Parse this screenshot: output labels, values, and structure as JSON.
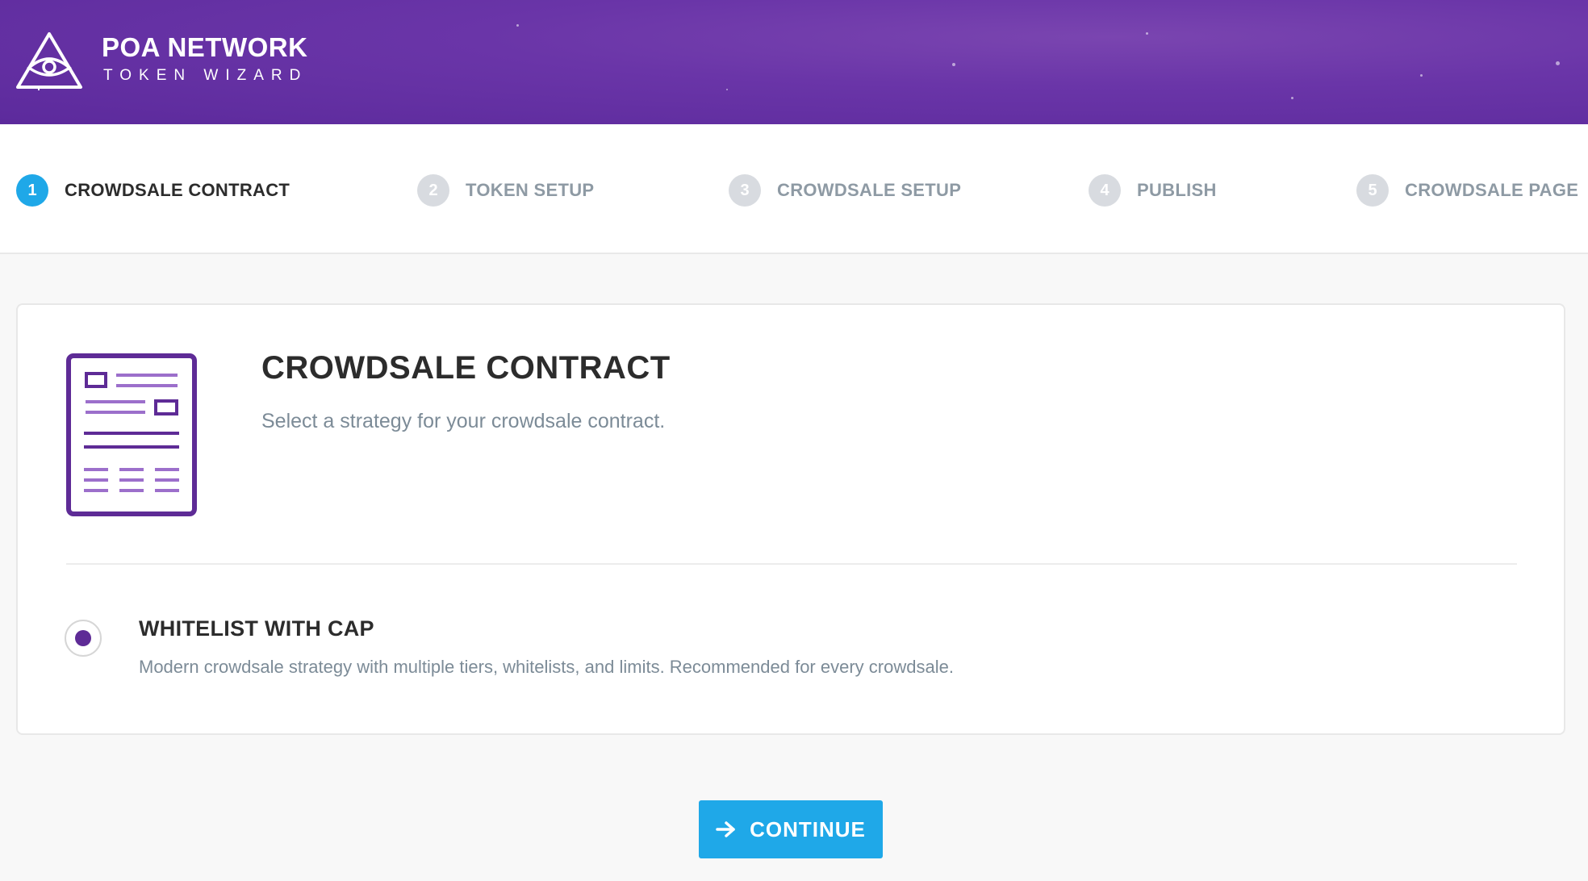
{
  "header": {
    "brand_title": "POA NETWORK",
    "brand_subtitle": "TOKEN WIZARD"
  },
  "stepper": {
    "steps": [
      {
        "number": "1",
        "label": "CROWDSALE CONTRACT",
        "active": true
      },
      {
        "number": "2",
        "label": "TOKEN SETUP",
        "active": false
      },
      {
        "number": "3",
        "label": "CROWDSALE SETUP",
        "active": false
      },
      {
        "number": "4",
        "label": "PUBLISH",
        "active": false
      },
      {
        "number": "5",
        "label": "CROWDSALE PAGE",
        "active": false
      }
    ]
  },
  "card": {
    "icon": "contract-document-icon",
    "title": "CROWDSALE CONTRACT",
    "description": "Select a strategy for your crowdsale contract.",
    "option": {
      "selected": true,
      "title": "WHITELIST WITH CAP",
      "description": "Modern crowdsale strategy with multiple tiers, whitelists, and limits. Recommended for every crowdsale."
    }
  },
  "footer": {
    "continue_label": "CONTINUE",
    "continue_icon": "arrow-right-icon"
  },
  "colors": {
    "header_purple": "#6a35a8",
    "accent_blue": "#1fa8e8",
    "icon_purple": "#5e2b96",
    "inactive_step": "#d8dbe0"
  }
}
